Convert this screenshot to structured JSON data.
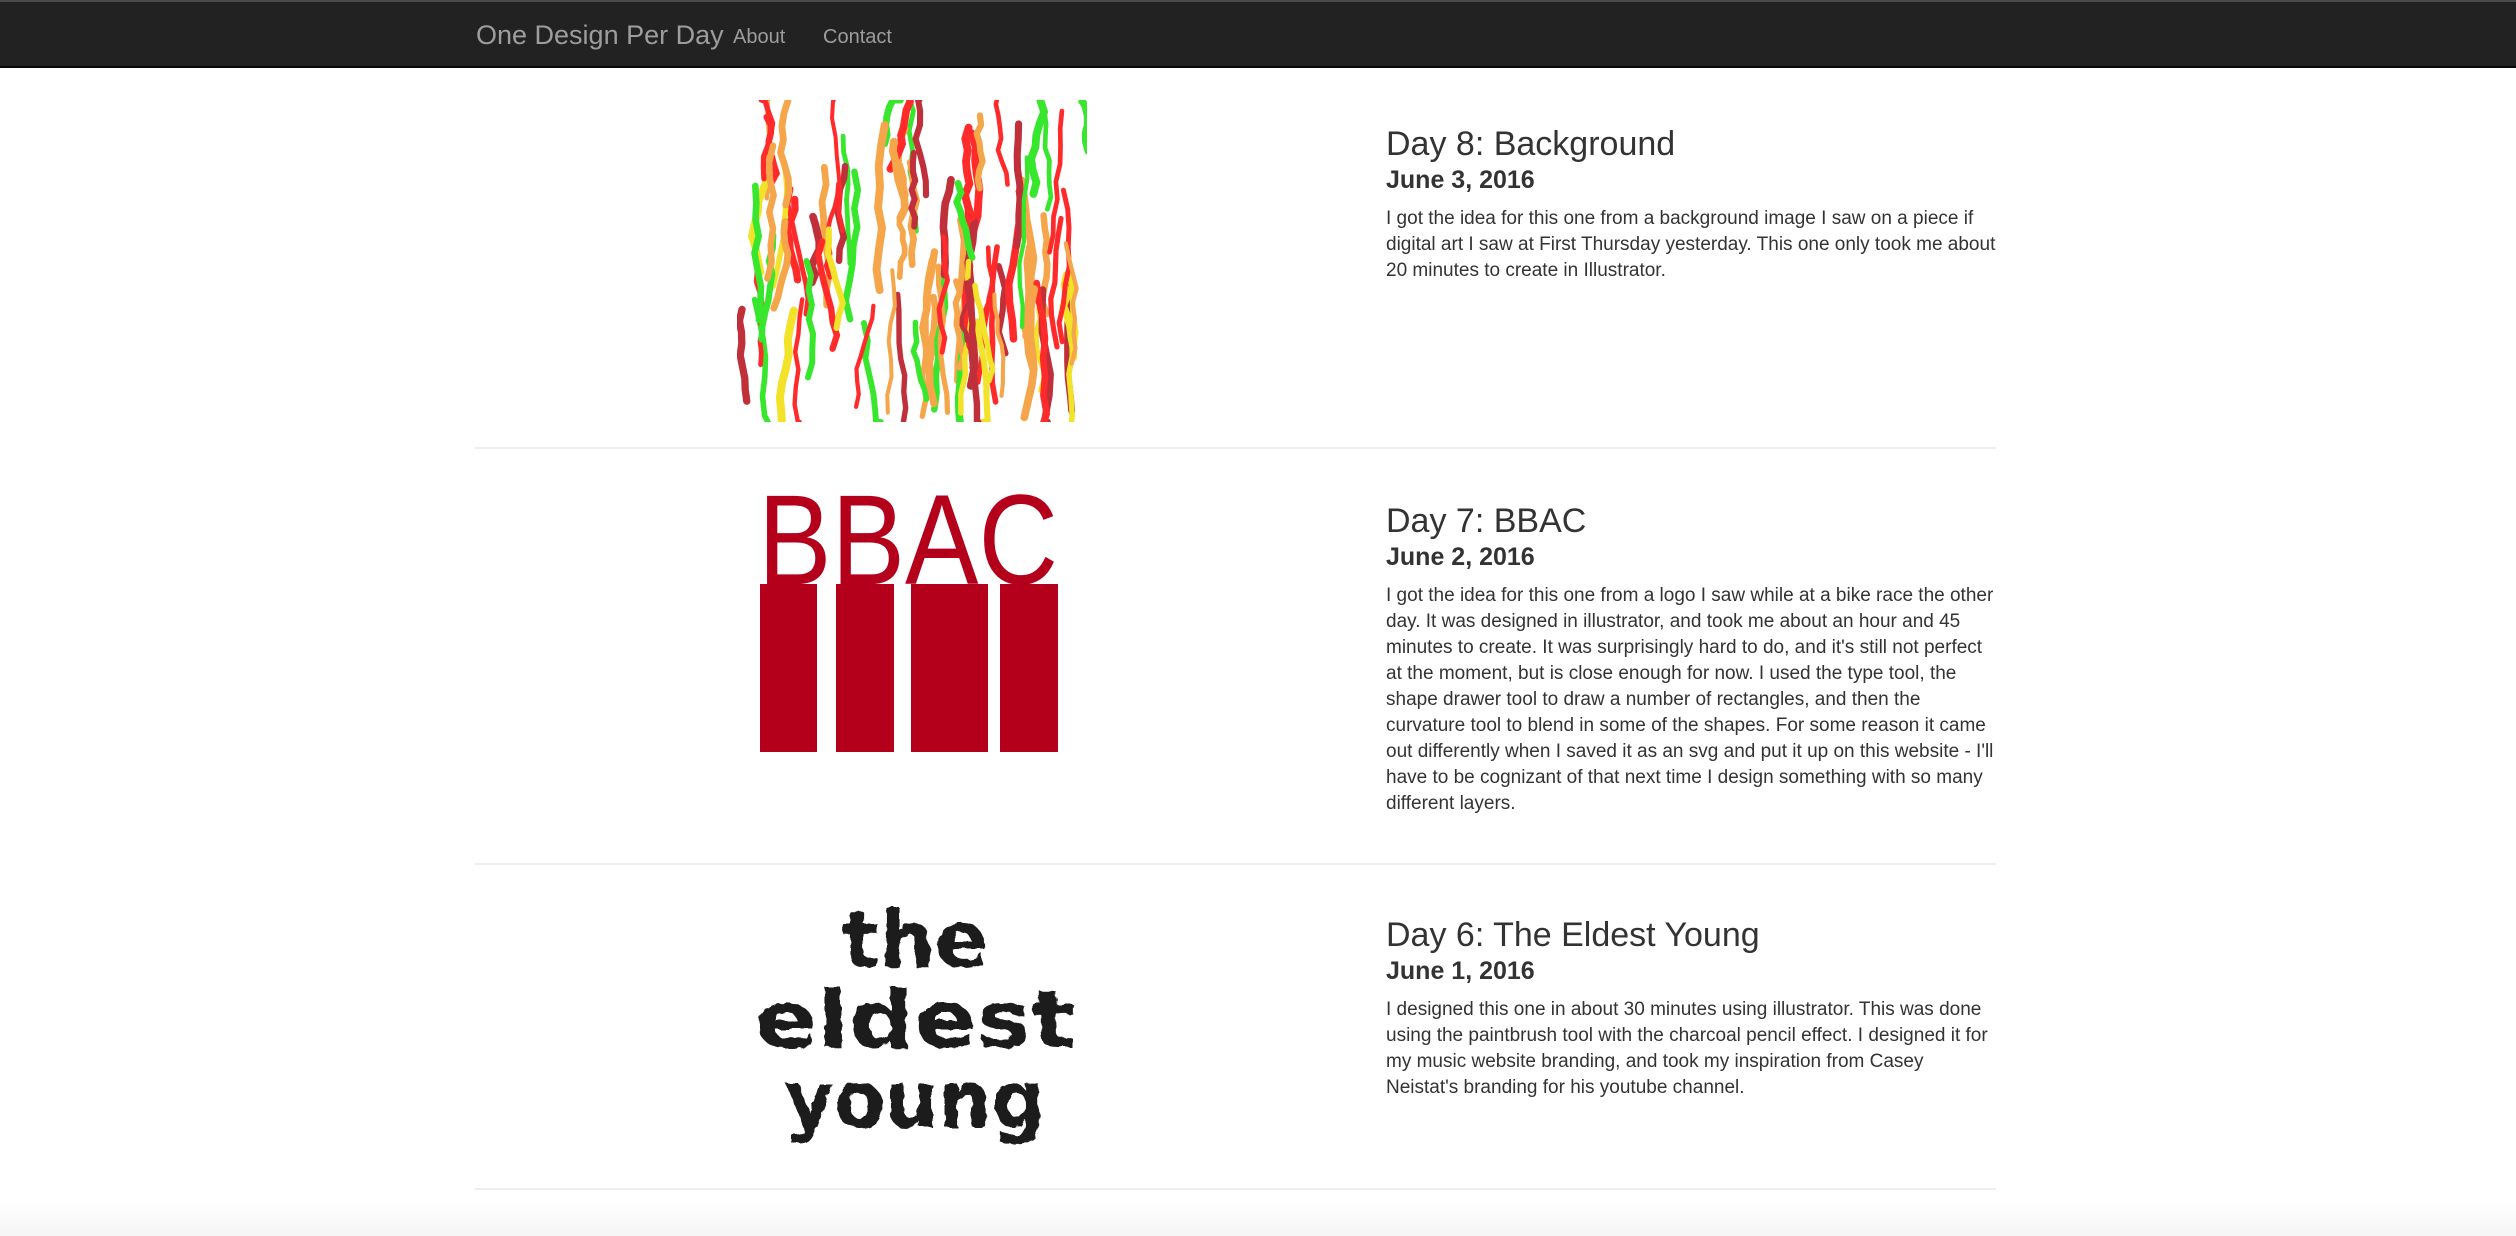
{
  "navbar": {
    "brand": "One Design Per Day",
    "links": [
      "About",
      "Contact"
    ]
  },
  "posts": [
    {
      "title": "Day 8: Background",
      "date": "June 3, 2016",
      "body": "I got the idea for this one from a background image I saw on a piece if digital art I saw at First Thursday yesterday. This one only took me about 20 minutes to create in Illustrator.",
      "image": "colorful-streaks-artwork"
    },
    {
      "title": "Day 7: BBAC",
      "date": "June 2, 2016",
      "body": "I got the idea for this one from a logo I saw while at a bike race the other day. It was designed in illustrator, and took me about an hour and 45 minutes to create. It was surprisingly hard to do, and it's still not perfect at the moment, but is close enough for now. I used the type tool, the shape drawer tool to draw a number of rectangles, and then the curvature tool to blend in some of the shapes. For some reason it came out differently when I saved it as an svg and put it up on this website - I'll have to be cognizant of that next time I design something with so many different layers.",
      "image": "bbac-logo",
      "image_text": "BBAC",
      "image_color": "#b5001c"
    },
    {
      "title": "Day 6: The Eldest Young",
      "date": "June 1, 2016",
      "body": "I designed this one in about 30 minutes using illustrator. This was done using the paintbrush tool with the charcoal pencil effect. I designed it for my music website branding, and took my inspiration from Casey Neistat's branding for his youtube channel.",
      "image": "the-eldest-young-logo",
      "image_lines": [
        "the",
        "eldest",
        "young"
      ]
    }
  ]
}
